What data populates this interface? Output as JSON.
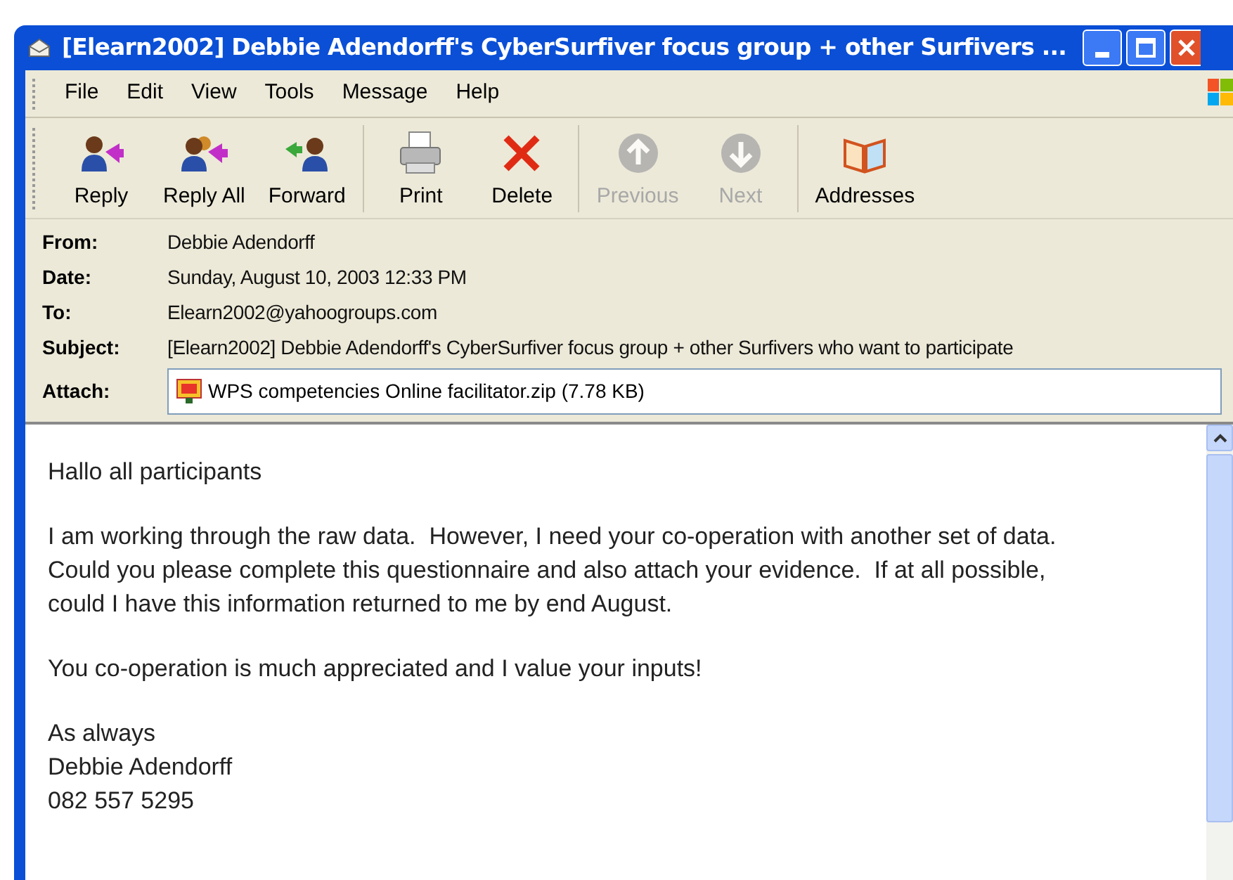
{
  "window": {
    "title": "[Elearn2002] Debbie Adendorff's CyberSurfiver focus group + other Surfivers ..."
  },
  "menu": [
    "File",
    "Edit",
    "View",
    "Tools",
    "Message",
    "Help"
  ],
  "toolbar": [
    {
      "label": "Reply",
      "disabled": false
    },
    {
      "label": "Reply All",
      "disabled": false
    },
    {
      "label": "Forward",
      "disabled": false
    },
    {
      "label": "Print",
      "disabled": false
    },
    {
      "label": "Delete",
      "disabled": false
    },
    {
      "label": "Previous",
      "disabled": true
    },
    {
      "label": "Next",
      "disabled": true
    },
    {
      "label": "Addresses",
      "disabled": false
    }
  ],
  "headers": [
    {
      "label": "From:",
      "value": "Debbie Adendorff"
    },
    {
      "label": "Date:",
      "value": "Sunday, August 10, 2003 12:33 PM"
    },
    {
      "label": "To:",
      "value": "Elearn2002@yahoogroups.com"
    },
    {
      "label": "Subject:",
      "value": "[Elearn2002] Debbie Adendorff's CyberSurfiver focus group + other Surfivers who want to participate"
    },
    {
      "label": "Attach:",
      "value": "WPS competencies Online facilitator.zip (7.78 KB)",
      "kind": "attachment"
    }
  ],
  "body": [
    [
      "Hallo all participants"
    ],
    [
      "I am working through the raw data.  However, I need your co-operation with another set of data.",
      "Could you please complete this questionnaire and also attach your evidence.  If at all possible,",
      "could I have this information returned to me by end August."
    ],
    [
      "You co-operation is much appreciated and I value your inputs!"
    ],
    [
      "As always",
      "Debbie Adendorff",
      "082 557 5295"
    ]
  ]
}
